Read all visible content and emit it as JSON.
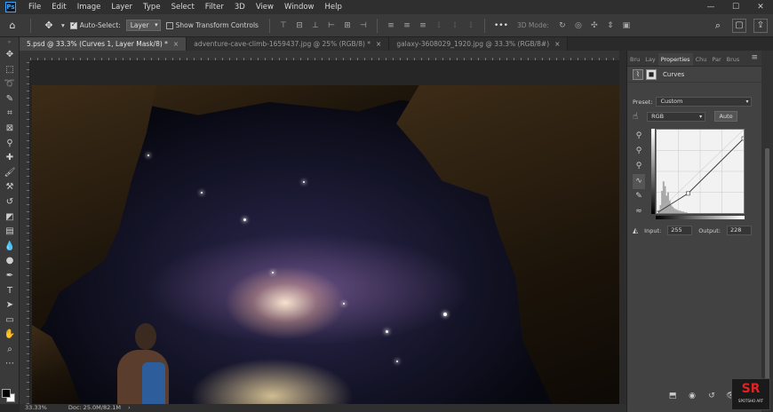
{
  "app": {
    "logo": "Ps"
  },
  "menu": [
    "File",
    "Edit",
    "Image",
    "Layer",
    "Type",
    "Select",
    "Filter",
    "3D",
    "View",
    "Window",
    "Help"
  ],
  "window_controls": {
    "minimize": "—",
    "maximize": "☐",
    "close": "✕"
  },
  "options_bar": {
    "auto_select_label": "Auto-Select:",
    "auto_select_checked": true,
    "auto_select_target": "Layer",
    "transform_label": "Show Transform Controls",
    "transform_checked": false,
    "mode_3d_label": "3D Mode:",
    "more_label": "•••"
  },
  "tabs": [
    {
      "label": "5.psd @ 33.3% (Curves 1, Layer Mask/8) *",
      "active": true
    },
    {
      "label": "adventure-cave-climb-1659437.jpg @ 25% (RGB/8) *",
      "active": false
    },
    {
      "label": "galaxy-3608029_1920.jpg @ 33.3% (RGB/8#)",
      "active": false
    }
  ],
  "tab_close": "×",
  "status": {
    "zoom": "33.33%",
    "doc": "Doc: 25.0M/82.1M",
    "arrow": "›"
  },
  "panel": {
    "tabs": [
      "Bru",
      "Lay",
      "Properties",
      "Chu",
      "Par",
      "Brus"
    ],
    "active_tab": "Properties",
    "adjustment_label": "Curves",
    "preset_label": "Preset:",
    "preset_value": "Custom",
    "channel_value": "RGB",
    "auto_label": "Auto",
    "input_label": "Input:",
    "input_value": "255",
    "output_label": "Output:",
    "output_value": "228"
  },
  "logo_stamp": {
    "mark": "SR",
    "text": "SPOTSHO ART"
  },
  "chart_data": {
    "type": "line",
    "xlim": [
      0,
      255
    ],
    "ylim": [
      0,
      255
    ],
    "series": [
      {
        "values": [
          [
            0,
            0
          ],
          [
            92,
            60
          ],
          [
            255,
            228
          ]
        ]
      }
    ],
    "histogram": [
      2,
      4,
      10,
      28,
      40,
      34,
      22,
      26,
      16,
      10,
      8,
      6,
      5,
      4,
      3,
      3,
      2,
      2,
      1,
      1
    ]
  }
}
